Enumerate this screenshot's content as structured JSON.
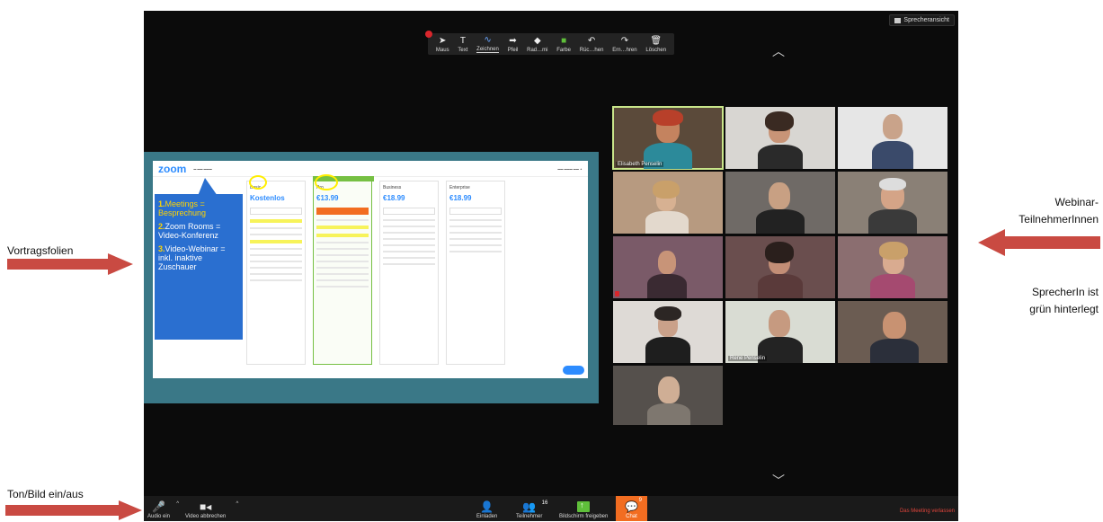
{
  "annotations": {
    "slides_label": "Vortragsfolien",
    "participants_label_line1": "Webinar-",
    "participants_label_line2": "TeilnehmerInnen",
    "speaker_note_line1": "SprecherIn ist",
    "speaker_note_line2": "grün hinterlegt",
    "av_label": "Ton/Bild ein/aus",
    "arrow_color": "#c94a42"
  },
  "zoom": {
    "view_button": "Sprecheransicht",
    "annotation_tools": [
      {
        "icon": "pointer-icon",
        "glyph": "➤",
        "label": "Maus"
      },
      {
        "icon": "text-icon",
        "glyph": "T",
        "label": "Text"
      },
      {
        "icon": "draw-icon",
        "glyph": "∿",
        "label": "Zeichnen"
      },
      {
        "icon": "arrow-icon",
        "glyph": "➡",
        "label": "Pfeil"
      },
      {
        "icon": "eraser-icon",
        "glyph": "◆",
        "label": "Rad…mi"
      },
      {
        "icon": "color-icon",
        "glyph": "■",
        "label": "Farbe"
      },
      {
        "icon": "undo-icon",
        "glyph": "↶",
        "label": "Rüc…hen"
      },
      {
        "icon": "redo-icon",
        "glyph": "↷",
        "label": "Ern…hren"
      },
      {
        "icon": "trash-icon",
        "glyph": "🗑",
        "label": "Löschen"
      }
    ],
    "slide": {
      "logo": "zoom",
      "callout_items": [
        {
          "num": "1.",
          "title": "Meetings",
          "rest": " = Besprechung"
        },
        {
          "num": "2.",
          "title": "Zoom Rooms",
          "rest": " = Video-Konferenz"
        },
        {
          "num": "3.",
          "title": "Video-Webinar",
          "rest": " = inkl. inaktive Zuschauer"
        }
      ],
      "plans": [
        {
          "name": "Basic",
          "price": "Kostenlos"
        },
        {
          "name": "Pro",
          "price": "€13.99"
        },
        {
          "name": "Business",
          "price": "€18.99"
        },
        {
          "name": "Enterprise",
          "price": "€18.99"
        }
      ]
    },
    "participants": [
      {
        "name": "Elisabeth Penselin"
      },
      {
        "name": "Rene Penselin"
      }
    ],
    "toolbar": {
      "audio": "Audio ein",
      "video": "Video abbrechen",
      "invite": "Einladen",
      "participants": "Teilnehmer",
      "participants_count": "16",
      "share": "Bildschirm freigeben",
      "chat": "Chat",
      "chat_count": "9",
      "leave": "Das Meeting verlassen"
    },
    "colors": {
      "toolbar_bg": "#1a1a1a",
      "chat_orange": "#f26d21",
      "share_green": "#5fbf3a",
      "active_speaker": "#c9e68a",
      "leave_red": "#e0443b"
    }
  }
}
